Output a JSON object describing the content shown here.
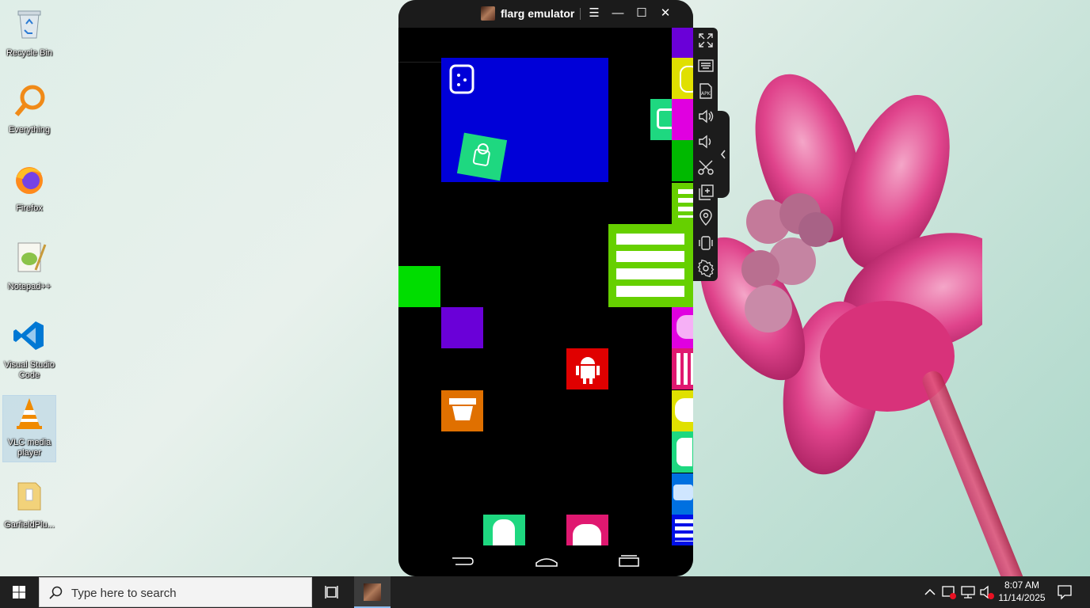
{
  "desktop": {
    "icons": [
      {
        "label": "Recycle Bin"
      },
      {
        "label": "Everything"
      },
      {
        "label": "Firefox"
      },
      {
        "label": "Notepad++"
      },
      {
        "label": "Visual Studio Code"
      },
      {
        "label": "VLC media player"
      },
      {
        "label": "GarfieldPlu..."
      }
    ]
  },
  "emulator": {
    "title": "flarg emulator",
    "controls": {
      "menu": "☰",
      "minimize": "—",
      "maximize": "☐",
      "close": "✕"
    },
    "colors": {
      "blue": "#0000d8",
      "green": "#00dd00",
      "purple": "#6a00d8",
      "red": "#e00000",
      "orange": "#e07000",
      "lime": "#66d000",
      "teal": "#1ed880",
      "magenta": "#e000e0",
      "yellow": "#e0e000",
      "darkgreen": "#00b900",
      "azure": "#0070e0",
      "navy": "#0010e8",
      "pink": "#e01870"
    }
  },
  "toolbar": {
    "buttons": [
      "fullscreen-icon",
      "keyboard-icon",
      "apk-install-icon",
      "volume-up-icon",
      "volume-down-icon",
      "screenshot-icon",
      "multi-instance-icon",
      "location-icon",
      "shake-icon",
      "settings-icon"
    ]
  },
  "taskbar": {
    "search_placeholder": "Type here to search",
    "time": "8:07 AM",
    "date": "11/14/2025"
  }
}
